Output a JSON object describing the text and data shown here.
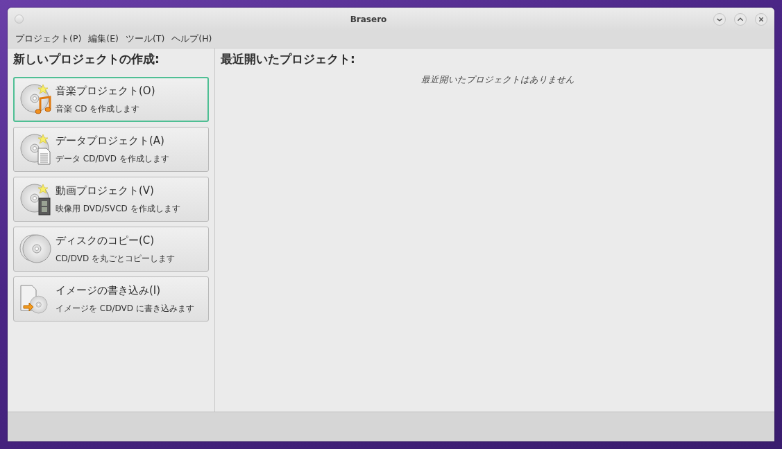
{
  "window": {
    "title": "Brasero"
  },
  "menu": [
    {
      "label": "プロジェクト(P)"
    },
    {
      "label": "編集(E)"
    },
    {
      "label": "ツール(T)"
    },
    {
      "label": "ヘルプ(H)"
    }
  ],
  "new_project": {
    "heading": "新しいプロジェクトの作成:",
    "items": [
      {
        "kind": "audio",
        "title": "音楽プロジェクト(O)",
        "description": "音楽 CD を作成します",
        "selected": true
      },
      {
        "kind": "data",
        "title": "データプロジェクト(A)",
        "description": "データ CD/DVD を作成します",
        "selected": false
      },
      {
        "kind": "video",
        "title": "動画プロジェクト(V)",
        "description": "映像用 DVD/SVCD を作成します",
        "selected": false
      },
      {
        "kind": "copy",
        "title": "ディスクのコピー(C)",
        "description": "CD/DVD を丸ごとコピーします",
        "selected": false
      },
      {
        "kind": "image",
        "title": "イメージの書き込み(I)",
        "description": "イメージを CD/DVD に書き込みます",
        "selected": false
      }
    ]
  },
  "recent": {
    "heading": "最近開いたプロジェクト:",
    "empty_message": "最近開いたプロジェクトはありません"
  }
}
